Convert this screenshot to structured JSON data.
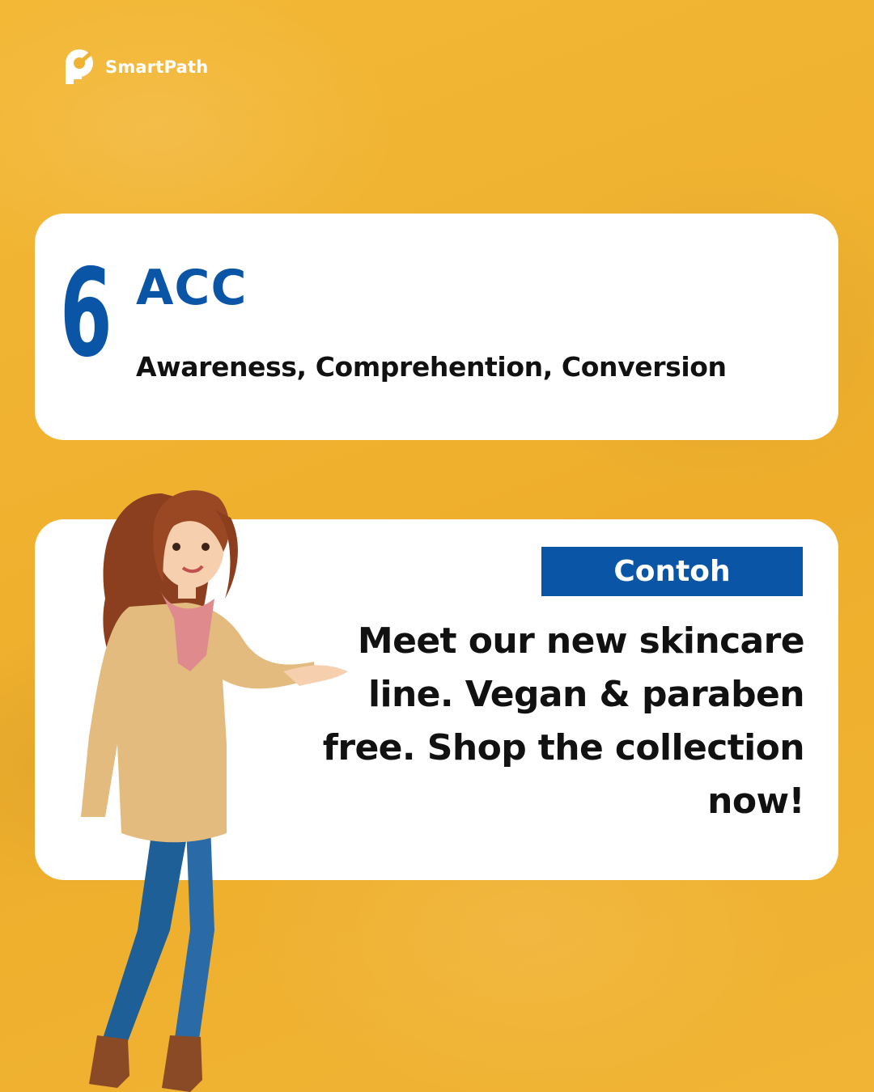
{
  "brand": {
    "name": "SmartPath",
    "icon": "smartpath-logo-icon"
  },
  "slide": {
    "number": "6",
    "title": "ACC",
    "subtitle": "Awareness, Comprehention, Conversion"
  },
  "example": {
    "badge": "Contoh",
    "text": "Meet our new skincare line. Vegan & paraben free. Shop the collection now!"
  },
  "illustration": {
    "icon": "woman-presenting-illustration"
  },
  "colors": {
    "background": "#f0b232",
    "accent": "#0a55a5",
    "card": "#ffffff",
    "text": "#111111"
  }
}
